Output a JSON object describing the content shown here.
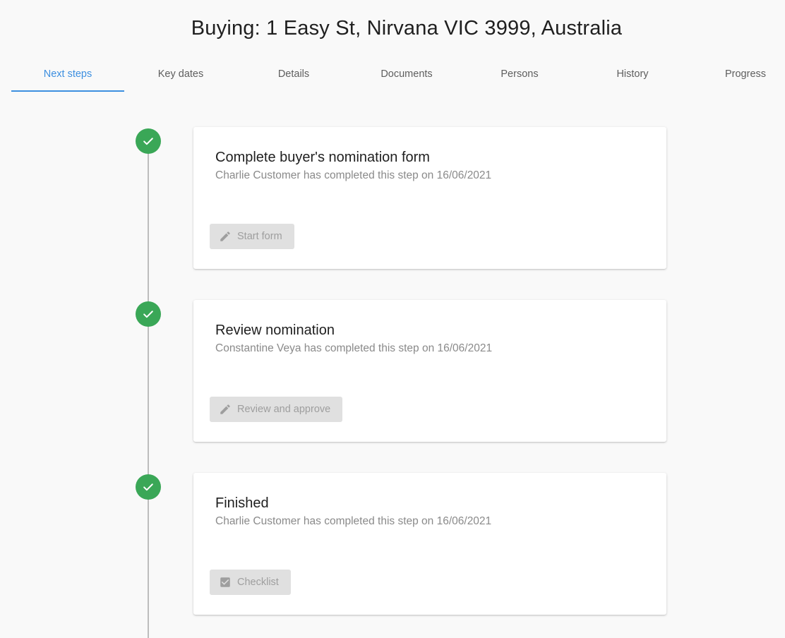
{
  "page": {
    "title": "Buying: 1 Easy St, Nirvana VIC 3999, Australia"
  },
  "tabs": [
    {
      "label": "Next steps",
      "active": true
    },
    {
      "label": "Key dates",
      "active": false
    },
    {
      "label": "Details",
      "active": false
    },
    {
      "label": "Documents",
      "active": false
    },
    {
      "label": "Persons",
      "active": false
    },
    {
      "label": "History",
      "active": false
    },
    {
      "label": "Progress",
      "active": false
    }
  ],
  "colors": {
    "accent": "#3d8fe0",
    "success": "#3aa757",
    "disabled_button_bg": "#e0e0e0",
    "disabled_text": "#9e9e9e"
  },
  "steps": [
    {
      "title": "Complete buyer's nomination form",
      "status": "Charlie Customer has completed this step on 16/06/2021",
      "button_label": "Start form",
      "button_icon": "pencil-icon",
      "completed": true
    },
    {
      "title": "Review nomination",
      "status": "Constantine Veya has completed this step on 16/06/2021",
      "button_label": "Review and approve",
      "button_icon": "pencil-icon",
      "completed": true
    },
    {
      "title": "Finished",
      "status": "Charlie Customer has completed this step on 16/06/2021",
      "button_label": "Checklist",
      "button_icon": "checkbox-icon",
      "completed": true
    }
  ]
}
